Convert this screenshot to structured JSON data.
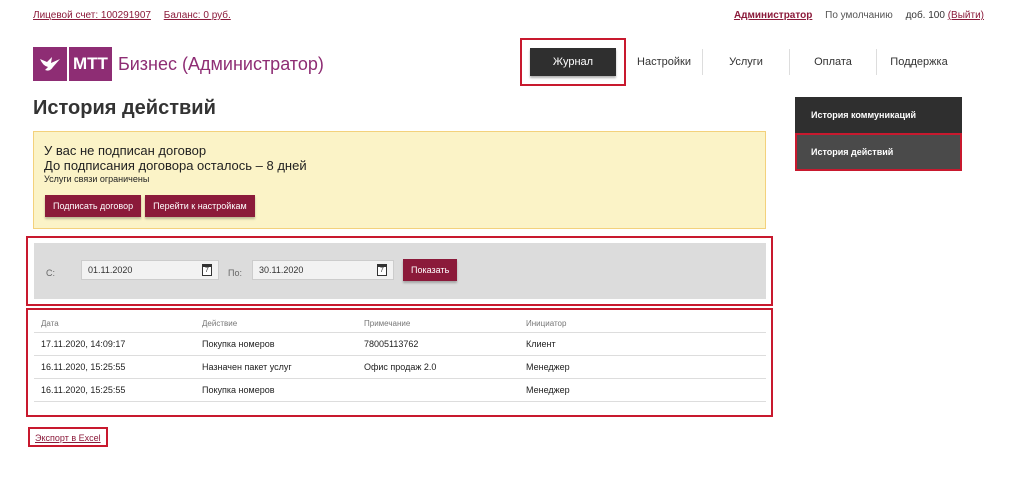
{
  "topbar": {
    "account": "Лицевой счет: 100291907",
    "balance": "Баланс: 0 руб.",
    "admin": "Администратор",
    "default": "По умолчанию",
    "ext": "доб. 100",
    "logout": "(Выйти)"
  },
  "logo": {
    "mtt": "МТТ",
    "business": "Бизнес (Администратор)",
    "icon": "bird-logo-icon"
  },
  "nav": {
    "items": [
      "Журнал",
      "Настройки",
      "Услуги",
      "Оплата",
      "Поддержка"
    ]
  },
  "page": {
    "title": "История действий"
  },
  "warning": {
    "line1": "У вас не подписан договор",
    "line2": "До подписания договора осталось – 8 дней",
    "line3": "Услуги связи ограничены",
    "sign_button": "Подписать договор",
    "settings_button": "Перейти к настройкам"
  },
  "filter": {
    "from_label": "С:",
    "from_value": "01.11.2020",
    "to_label": "По:",
    "to_value": "30.11.2020",
    "calendar_icon": "calendar-icon",
    "show_button": "Показать"
  },
  "table": {
    "headers": [
      "Дата",
      "Действие",
      "Примечание",
      "Инициатор"
    ],
    "rows": [
      [
        "17.11.2020, 14:09:17",
        "Покупка номеров",
        "78005113762",
        "Клиент"
      ],
      [
        "16.11.2020, 15:25:55",
        "Назначен пакет услуг",
        "Офис продаж 2.0",
        "Менеджер"
      ],
      [
        "16.11.2020, 15:25:55",
        "Покупка номеров",
        "",
        "Менеджер"
      ]
    ]
  },
  "export": {
    "label": "Экспорт в Excel"
  },
  "sidebar": {
    "items": [
      "История коммуникаций",
      "История действий"
    ],
    "active_index": 1
  },
  "colors": {
    "accent": "#8b1a3a",
    "brand": "#8e2d74",
    "highlight": "#c8192e",
    "warning_bg": "#fbf3c7"
  }
}
